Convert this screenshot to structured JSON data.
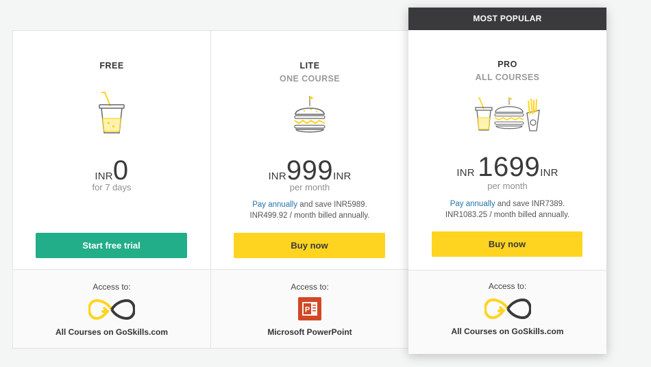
{
  "plans": {
    "free": {
      "name": "FREE",
      "currency": "INR",
      "amount": "0",
      "period": "for 7 days",
      "button_label": "Start free trial",
      "access_label": "Access to:",
      "product": "All Courses on GoSkills.com",
      "illustration": "drink-cup-icon",
      "product_icon": "goskills-infinity-logo"
    },
    "lite": {
      "name": "LITE",
      "subtitle": "ONE COURSE",
      "currency": "INR",
      "amount": "999",
      "currency_suffix": "INR",
      "period": "per month",
      "annual_link": "Pay annually",
      "annual_text": " and save INR5989.",
      "monthly_billed": "INR499.92 / month billed annually.",
      "button_label": "Buy now",
      "access_label": "Access to:",
      "product": "Microsoft PowerPoint",
      "illustration": "burger-icon",
      "product_icon": "powerpoint-logo"
    },
    "pro": {
      "ribbon": "MOST POPULAR",
      "name": "PRO",
      "subtitle": "ALL COURSES",
      "currency": "INR",
      "amount": "1699",
      "currency_suffix": "INR",
      "period": "per month",
      "annual_link": "Pay annually",
      "annual_text": " and save INR7389.",
      "monthly_billed": "INR1083.25 / month billed annually.",
      "button_label": "Buy now",
      "access_label": "Access to:",
      "product": "All Courses on GoSkills.com",
      "illustration": "meal-combo-icon",
      "product_icon": "goskills-infinity-logo"
    }
  },
  "colors": {
    "green": "#21ae89",
    "yellow": "#ffd420",
    "ribbon": "#3a3a3c",
    "link": "#2273a8",
    "powerpoint": "#d24726"
  }
}
